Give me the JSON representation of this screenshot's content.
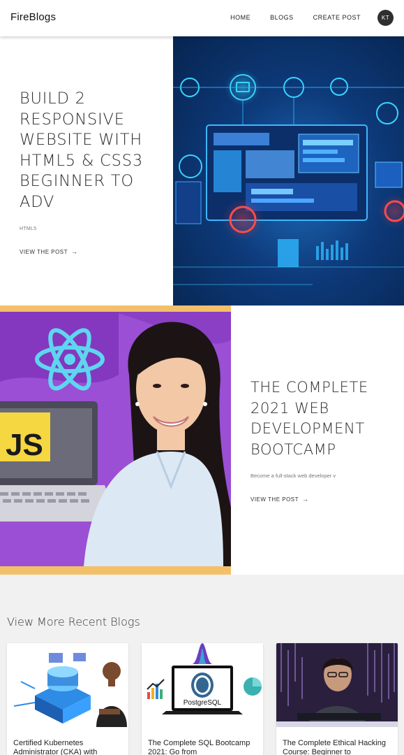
{
  "nav": {
    "brand": "FireBlogs",
    "links": [
      "HOME",
      "BLOGS",
      "CREATE POST"
    ],
    "avatar_initials": "KT"
  },
  "featured": [
    {
      "title": "BUILD 2 RESPONSIVE WEBSITE WITH HTML5 & CSS3 BEGINNER TO ADV",
      "tag": "HTML5",
      "link_label": "VIEW THE POST",
      "image_icon": "web-dev-illustration"
    },
    {
      "title": "THE COMPLETE 2021 WEB DEVELOPMENT BOOTCAMP",
      "description": "Become a full-stack web developer v",
      "link_label": "VIEW THE POST",
      "image_icon": "bootcamp-course-cover"
    }
  ],
  "recent": {
    "heading": "View More Recent Blogs",
    "cards": [
      {
        "title": "Certified Kubernetes Administrator (CKA) with",
        "image_icon": "kubernetes-cover"
      },
      {
        "title": "The Complete SQL Bootcamp 2021: Go from",
        "image_icon": "postgresql-cover"
      },
      {
        "title": "The Complete Ethical Hacking Course: Beginner to",
        "image_icon": "hacking-cover"
      }
    ],
    "image_labels": {
      "js": "JS",
      "postgres": "PostgreSQL"
    }
  },
  "colors": {
    "section2_border": "#f3c06a",
    "section2_bg": "#8a3fc4",
    "hero1_bg": "#0d3a7a",
    "recent_bg": "#f1f1f1"
  }
}
